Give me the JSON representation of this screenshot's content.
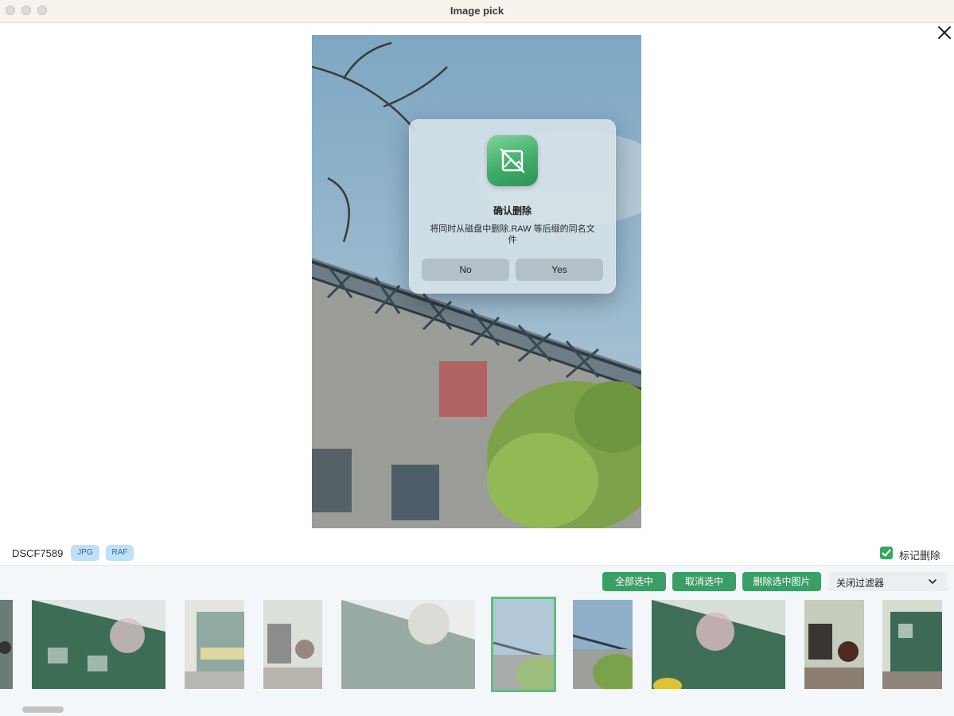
{
  "window": {
    "title": "Image pick"
  },
  "photo": {
    "name": "DSCF7589",
    "formats": [
      "JPG",
      "RAF"
    ]
  },
  "dialog": {
    "title": "确认删除",
    "message": "将同时从磁盘中删除.RAW 等后缀的同名文件",
    "no_label": "No",
    "yes_label": "Yes"
  },
  "toolbar": {
    "select_all_label": "全部选中",
    "deselect_label": "取消选中",
    "delete_selected_label": "删除选中图片",
    "filter_value": "关闭过滤器"
  },
  "mark_delete": {
    "label": "标记删除",
    "checked": true
  },
  "colors": {
    "accent": "#3a9e66",
    "tag_bg": "#bfe0f5",
    "selection_border": "#5bbf7b"
  }
}
